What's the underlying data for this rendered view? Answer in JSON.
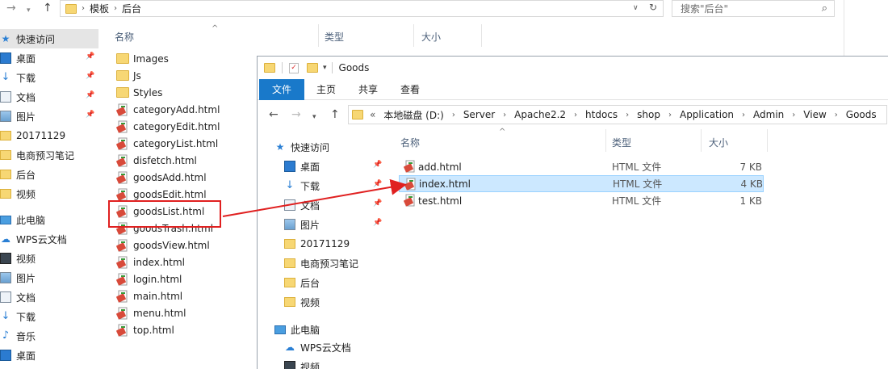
{
  "bg": {
    "address": {
      "segments": [
        "模板",
        "后台"
      ]
    },
    "search_placeholder": "搜索\"后台\"",
    "columns": {
      "name": "名称",
      "type": "类型",
      "size": "大小"
    },
    "sidebar": [
      {
        "label": "快速访问",
        "icon": "star-icon",
        "pinned": false,
        "selected": true
      },
      {
        "label": "桌面",
        "icon": "desktop-icon",
        "pinned": true
      },
      {
        "label": "下载",
        "icon": "download-icon",
        "pinned": true
      },
      {
        "label": "文档",
        "icon": "documents-icon",
        "pinned": true
      },
      {
        "label": "图片",
        "icon": "pictures-icon",
        "pinned": true
      },
      {
        "label": "20171129",
        "icon": "folder-icon"
      },
      {
        "label": "电商预习笔记",
        "icon": "folder-icon"
      },
      {
        "label": "后台",
        "icon": "folder-icon"
      },
      {
        "label": "视频",
        "icon": "folder-icon"
      },
      {
        "label": "此电脑",
        "icon": "computer-icon"
      },
      {
        "label": "WPS云文档",
        "icon": "cloud-icon"
      },
      {
        "label": "视频",
        "icon": "videos-icon"
      },
      {
        "label": "图片",
        "icon": "pictures-icon"
      },
      {
        "label": "文档",
        "icon": "documents-icon"
      },
      {
        "label": "下载",
        "icon": "download-icon"
      },
      {
        "label": "音乐",
        "icon": "music-icon"
      },
      {
        "label": "桌面",
        "icon": "desktop-icon"
      }
    ],
    "files": [
      {
        "name": "Images",
        "kind": "folder"
      },
      {
        "name": "Js",
        "kind": "folder"
      },
      {
        "name": "Styles",
        "kind": "folder"
      },
      {
        "name": "categoryAdd.html",
        "kind": "html"
      },
      {
        "name": "categoryEdit.html",
        "kind": "html"
      },
      {
        "name": "categoryList.html",
        "kind": "html"
      },
      {
        "name": "disfetch.html",
        "kind": "html"
      },
      {
        "name": "goodsAdd.html",
        "kind": "html"
      },
      {
        "name": "goodsEdit.html",
        "kind": "html"
      },
      {
        "name": "goodsList.html",
        "kind": "html"
      },
      {
        "name": "goodsTrash.html",
        "kind": "html"
      },
      {
        "name": "goodsView.html",
        "kind": "html"
      },
      {
        "name": "index.html",
        "kind": "html"
      },
      {
        "name": "login.html",
        "kind": "html"
      },
      {
        "name": "main.html",
        "kind": "html"
      },
      {
        "name": "menu.html",
        "kind": "html"
      },
      {
        "name": "top.html",
        "kind": "html"
      }
    ]
  },
  "fg": {
    "title": "Goods",
    "ribbon_tabs": [
      "文件",
      "主页",
      "共享",
      "查看"
    ],
    "address": {
      "prefix": "«",
      "segments": [
        "本地磁盘 (D:)",
        "Server",
        "Apache2.2",
        "htdocs",
        "shop",
        "Application",
        "Admin",
        "View",
        "Goods"
      ]
    },
    "columns": {
      "name": "名称",
      "type": "类型",
      "size": "大小"
    },
    "sidebar": [
      {
        "label": "快速访问",
        "icon": "star-icon"
      },
      {
        "label": "桌面",
        "icon": "desktop-icon",
        "pinned": true
      },
      {
        "label": "下载",
        "icon": "download-icon",
        "pinned": true
      },
      {
        "label": "文档",
        "icon": "documents-icon",
        "pinned": true
      },
      {
        "label": "图片",
        "icon": "pictures-icon",
        "pinned": true
      },
      {
        "label": "20171129",
        "icon": "folder-icon"
      },
      {
        "label": "电商预习笔记",
        "icon": "folder-icon"
      },
      {
        "label": "后台",
        "icon": "folder-icon"
      },
      {
        "label": "视频",
        "icon": "folder-icon"
      },
      {
        "label": "此电脑",
        "icon": "computer-icon"
      },
      {
        "label": "WPS云文档",
        "icon": "cloud-icon"
      },
      {
        "label": "视频",
        "icon": "videos-icon"
      }
    ],
    "files": [
      {
        "name": "add.html",
        "type": "HTML 文件",
        "size": "7 KB",
        "selected": false
      },
      {
        "name": "index.html",
        "type": "HTML 文件",
        "size": "4 KB",
        "selected": true
      },
      {
        "name": "test.html",
        "type": "HTML 文件",
        "size": "1 KB",
        "selected": false
      }
    ]
  },
  "colors": {
    "accent": "#1979ca",
    "annotation": "#e02020",
    "selection": "#cce8ff",
    "folder": "#f7d774"
  }
}
